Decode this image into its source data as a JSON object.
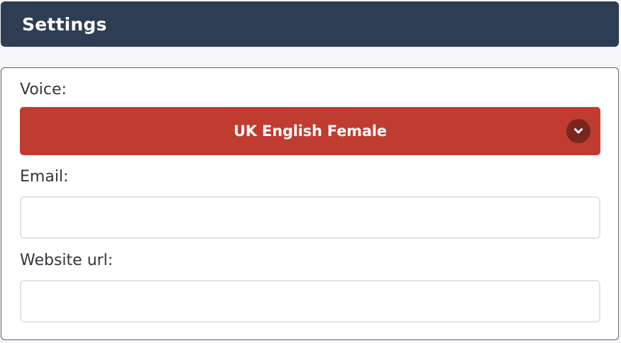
{
  "header": {
    "title": "Settings"
  },
  "form": {
    "voice": {
      "label": "Voice:",
      "selected": "UK English Female",
      "icon": "chevron-down-icon"
    },
    "email": {
      "label": "Email:",
      "value": "",
      "placeholder": ""
    },
    "website": {
      "label": "Website url:",
      "value": "",
      "placeholder": ""
    }
  },
  "colors": {
    "header_bg": "#2f3d54",
    "select_bg": "#c03b30",
    "chevron_bg": "#7a2620",
    "panel_border": "#5f636b"
  }
}
